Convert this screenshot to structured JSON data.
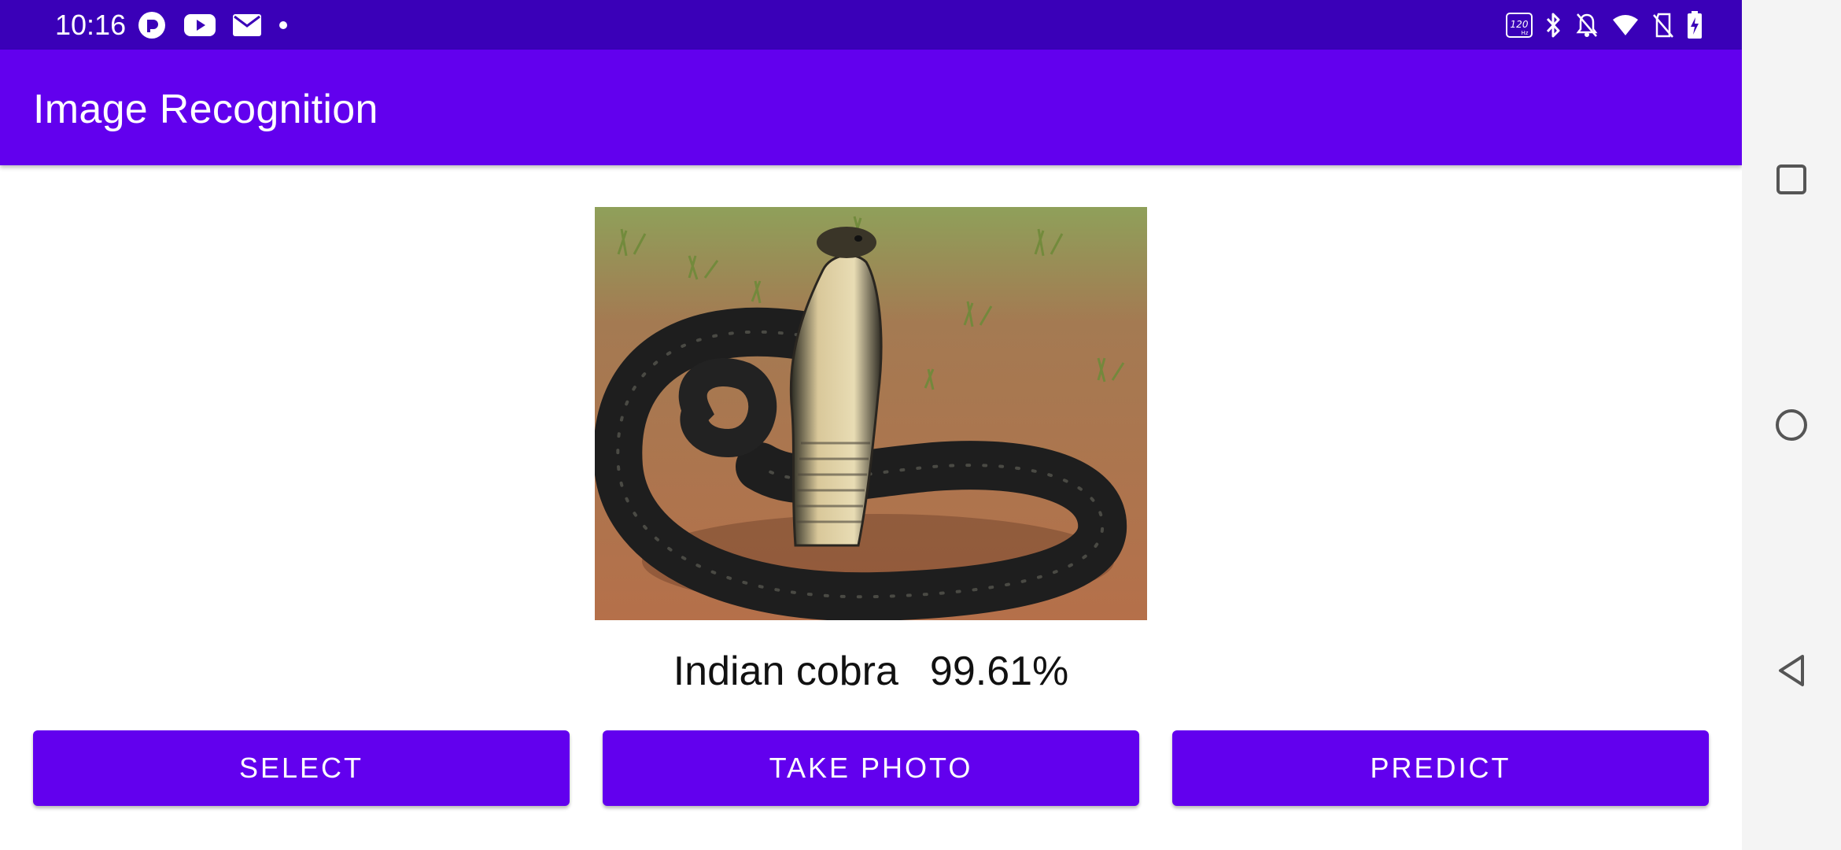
{
  "status_bar": {
    "time": "10:16",
    "left_icons": [
      "pocket-casts-icon",
      "youtube-icon",
      "gmail-icon",
      "notification-dot-icon"
    ],
    "right_icons": [
      "refresh-rate-120hz-icon",
      "bluetooth-icon",
      "notifications-off-icon",
      "wifi-icon",
      "no-sim-icon",
      "battery-charging-icon"
    ],
    "refresh_rate_label": "120 Hz"
  },
  "app_bar": {
    "title": "Image Recognition"
  },
  "main": {
    "image_subject": "Indian cobra",
    "result_label": "Indian cobra",
    "result_confidence": "99.61%"
  },
  "buttons": {
    "select": "SELECT",
    "take_photo": "TAKE PHOTO",
    "predict": "PREDICT"
  },
  "nav_bar": {
    "items": [
      "recents-square-icon",
      "home-circle-icon",
      "back-triangle-icon"
    ]
  },
  "colors": {
    "status_bar": "#3a00b8",
    "primary": "#6200ee",
    "nav_bar_bg": "#f4f4f4",
    "text": "#111111"
  }
}
